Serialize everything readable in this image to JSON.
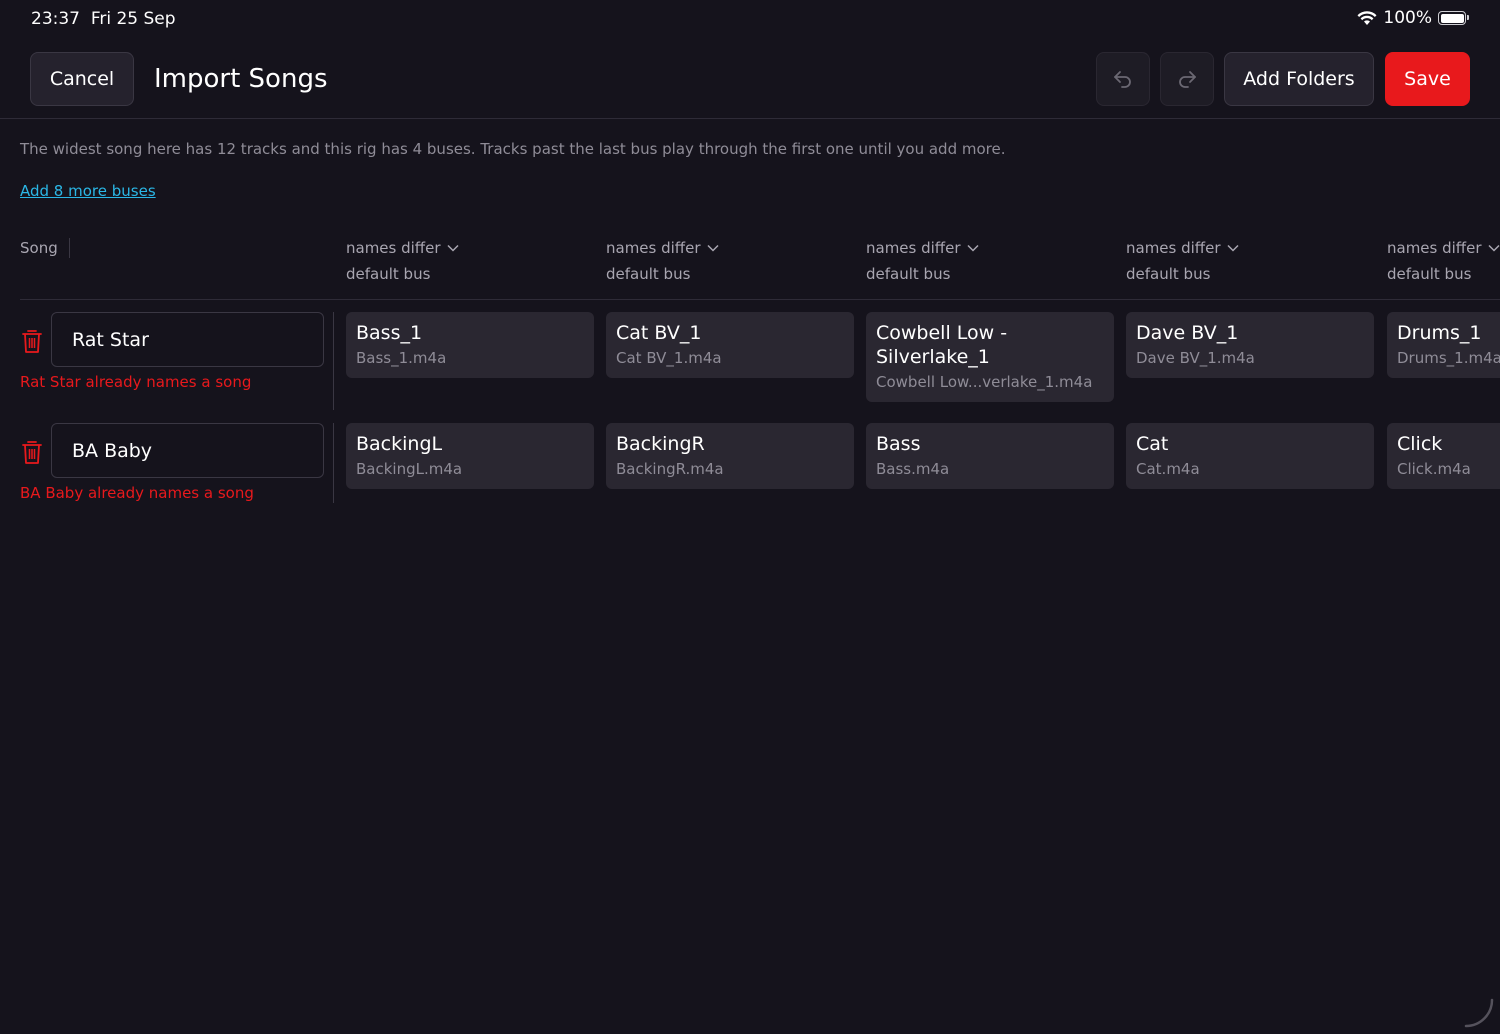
{
  "status_bar": {
    "time": "23:37",
    "date": "Fri 25 Sep",
    "battery_percent": "100%",
    "icons": [
      "wifi-icon",
      "battery-icon"
    ]
  },
  "nav": {
    "cancel_label": "Cancel",
    "title": "Import Songs",
    "undo_icon": "undo-icon",
    "redo_icon": "redo-icon",
    "add_folders_label": "Add Folders",
    "save_label": "Save"
  },
  "info": {
    "message": "The widest song here has 12 tracks and this rig has 4 buses. Tracks past the last bus play through the first one until you add more.",
    "add_buses_link": "Add 8 more buses"
  },
  "table": {
    "song_header": "Song",
    "bus_columns": [
      {
        "name": "names differ",
        "subtitle": "default bus"
      },
      {
        "name": "names differ",
        "subtitle": "default bus"
      },
      {
        "name": "names differ",
        "subtitle": "default bus"
      },
      {
        "name": "names differ",
        "subtitle": "default bus"
      },
      {
        "name": "names differ",
        "subtitle": "default bus"
      }
    ],
    "songs": [
      {
        "name": "Rat Star",
        "error": "Rat Star already names a song",
        "tracks": [
          {
            "name": "Bass_1",
            "file": "Bass_1.m4a"
          },
          {
            "name": "Cat BV_1",
            "file": "Cat BV_1.m4a"
          },
          {
            "name": "Cowbell Low - Silverlake_1",
            "file": "Cowbell Low...verlake_1.m4a"
          },
          {
            "name": "Dave BV_1",
            "file": "Dave BV_1.m4a"
          },
          {
            "name": "Drums_1",
            "file": "Drums_1.m4a"
          }
        ]
      },
      {
        "name": "BA Baby",
        "error": "BA Baby already names a song",
        "tracks": [
          {
            "name": "BackingL",
            "file": "BackingL.m4a"
          },
          {
            "name": "BackingR",
            "file": "BackingR.m4a"
          },
          {
            "name": "Bass",
            "file": "Bass.m4a"
          },
          {
            "name": "Cat",
            "file": "Cat.m4a"
          },
          {
            "name": "Click",
            "file": "Click.m4a"
          }
        ]
      }
    ]
  },
  "colors": {
    "background": "#15131c",
    "card": "#2a2731",
    "accent_red": "#e8191c",
    "link": "#2bb7e6",
    "muted_text": "#8f8c97"
  }
}
